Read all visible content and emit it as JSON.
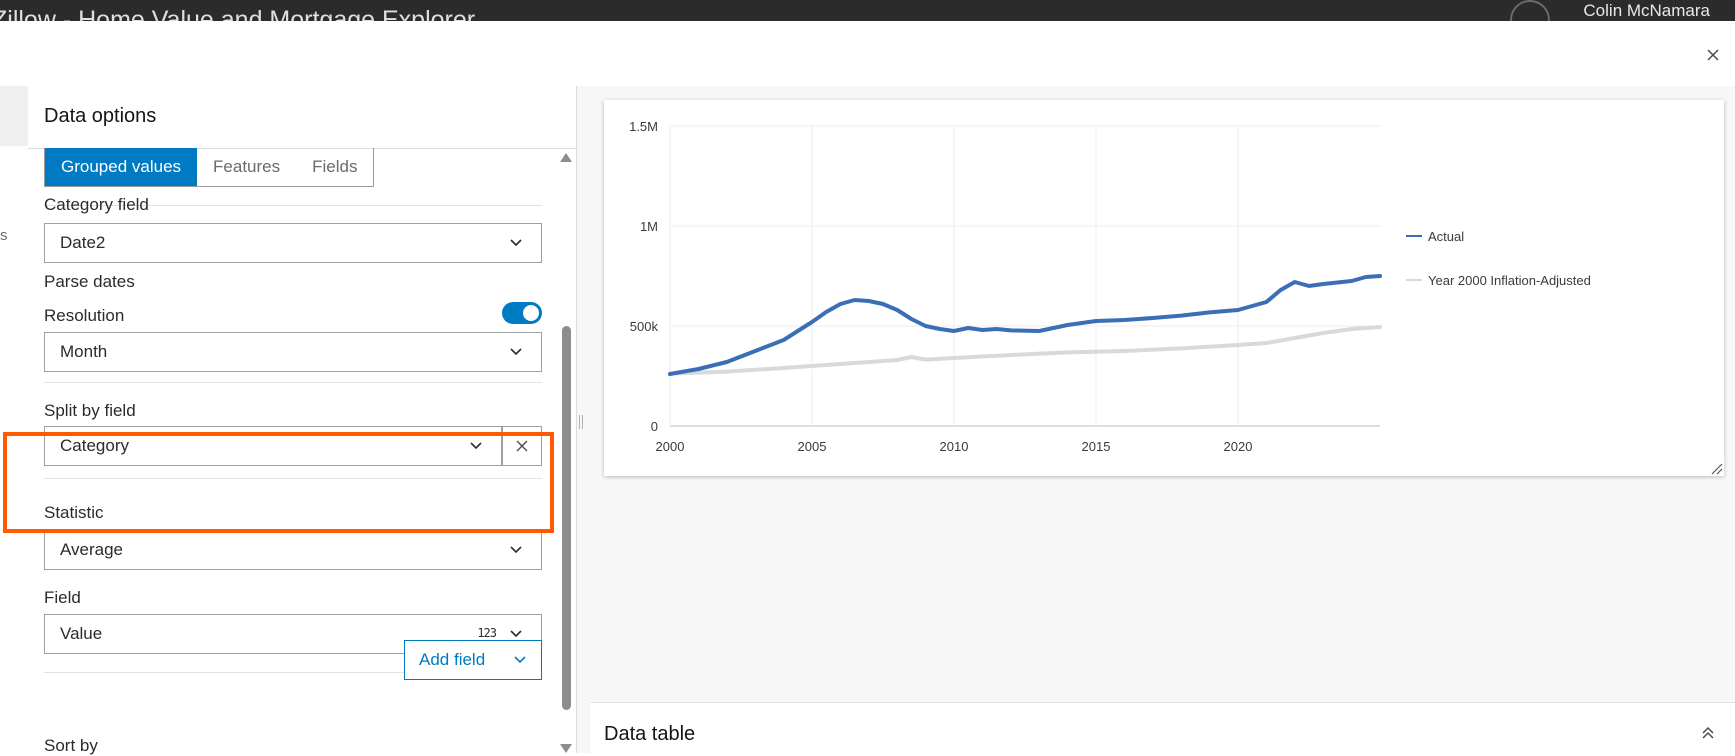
{
  "app": {
    "title": "Zillow - Home Value and Mortgage Explorer",
    "user_name": "Colin McNamara"
  },
  "left_strip": {
    "partial_text": "s"
  },
  "panel": {
    "title": "Data options",
    "tabs": [
      {
        "label": "Grouped values",
        "active": true
      },
      {
        "label": "Features",
        "active": false
      },
      {
        "label": "Fields",
        "active": false
      }
    ],
    "category_field": {
      "label": "Category field",
      "value": "Date2"
    },
    "parse_dates": {
      "label": "Parse dates",
      "enabled": true
    },
    "resolution": {
      "label": "Resolution",
      "value": "Month"
    },
    "split_by": {
      "label": "Split by field",
      "value": "Category"
    },
    "statistic": {
      "label": "Statistic",
      "value": "Average"
    },
    "field": {
      "label": "Field",
      "value": "Value",
      "type_badge": "123"
    },
    "sort_by": {
      "label": "Sort by",
      "add_button": "Add field"
    }
  },
  "data_table": {
    "title": "Data table"
  },
  "colors": {
    "accent": "#007ac2",
    "highlight": "#ff5a00",
    "actual": "#3a6fb7",
    "inflation": "#d9d9d9"
  },
  "chart_data": {
    "type": "line",
    "x_ticks": [
      "2000",
      "2005",
      "2010",
      "2015",
      "2020"
    ],
    "y_ticks": [
      "0",
      "500k",
      "1M",
      "1.5M"
    ],
    "xlim": [
      2000,
      2025
    ],
    "ylim": [
      0,
      1500000
    ],
    "grid": true,
    "legend_position": "right",
    "series": [
      {
        "name": "Actual",
        "color": "#3a6fb7",
        "points": [
          [
            2000,
            260000
          ],
          [
            2001,
            285000
          ],
          [
            2002,
            320000
          ],
          [
            2003,
            375000
          ],
          [
            2004,
            430000
          ],
          [
            2005,
            520000
          ],
          [
            2005.5,
            570000
          ],
          [
            2006,
            610000
          ],
          [
            2006.5,
            630000
          ],
          [
            2007,
            625000
          ],
          [
            2007.5,
            610000
          ],
          [
            2008,
            580000
          ],
          [
            2008.5,
            535000
          ],
          [
            2009,
            500000
          ],
          [
            2009.5,
            485000
          ],
          [
            2010,
            475000
          ],
          [
            2010.5,
            490000
          ],
          [
            2011,
            480000
          ],
          [
            2011.5,
            485000
          ],
          [
            2012,
            478000
          ],
          [
            2013,
            475000
          ],
          [
            2014,
            505000
          ],
          [
            2015,
            525000
          ],
          [
            2016,
            530000
          ],
          [
            2017,
            540000
          ],
          [
            2018,
            552000
          ],
          [
            2019,
            568000
          ],
          [
            2020,
            580000
          ],
          [
            2021,
            620000
          ],
          [
            2021.5,
            680000
          ],
          [
            2022,
            720000
          ],
          [
            2022.5,
            700000
          ],
          [
            2023,
            710000
          ],
          [
            2024,
            725000
          ],
          [
            2024.5,
            745000
          ],
          [
            2025,
            750000
          ]
        ]
      },
      {
        "name": "Year 2000 Inflation-Adjusted",
        "color": "#d9d9d9",
        "points": [
          [
            2000,
            262000
          ],
          [
            2002,
            272000
          ],
          [
            2004,
            290000
          ],
          [
            2006,
            310000
          ],
          [
            2008,
            330000
          ],
          [
            2008.5,
            345000
          ],
          [
            2009,
            332000
          ],
          [
            2010,
            340000
          ],
          [
            2012,
            355000
          ],
          [
            2014,
            368000
          ],
          [
            2016,
            375000
          ],
          [
            2018,
            388000
          ],
          [
            2020,
            405000
          ],
          [
            2021,
            415000
          ],
          [
            2022,
            440000
          ],
          [
            2023,
            465000
          ],
          [
            2024,
            485000
          ],
          [
            2025,
            495000
          ]
        ]
      }
    ]
  }
}
